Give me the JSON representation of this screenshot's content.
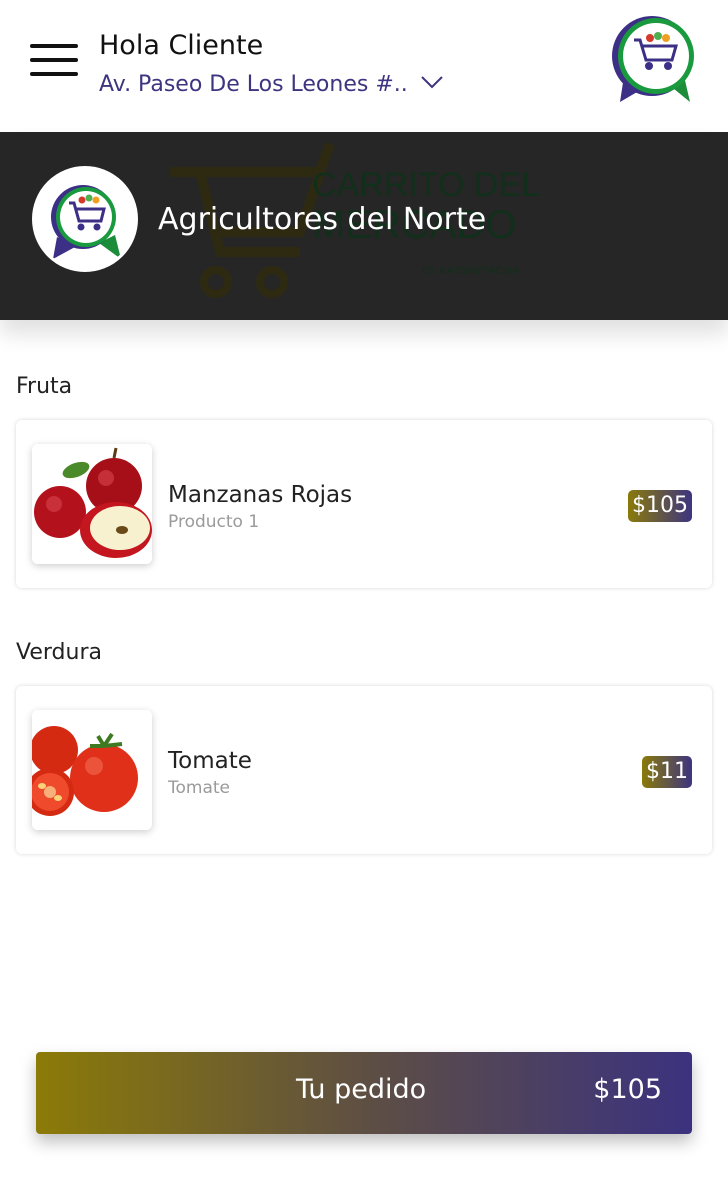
{
  "header": {
    "greeting": "Hola Cliente",
    "address": "Av. Paseo De Los Leones #.."
  },
  "banner": {
    "store_name": "Agricultores del Norte",
    "watermark_line1": "CARRITO DEL",
    "watermark_line2": "MERCADO",
    "watermark_line3": "BY KAYSAYPACHA"
  },
  "sections": [
    {
      "title": "Fruta",
      "products": [
        {
          "name": "Manzanas Rojas",
          "subtitle": "Producto 1",
          "price": "$105"
        }
      ]
    },
    {
      "title": "Verdura",
      "products": [
        {
          "name": "Tomate",
          "subtitle": "Tomate",
          "price": "$11"
        }
      ]
    }
  ],
  "order": {
    "label": "Tu pedido",
    "total": "$105"
  },
  "colors": {
    "accent_purple": "#3d3580",
    "accent_olive": "#8c7b07",
    "banner_bg": "#262626"
  }
}
